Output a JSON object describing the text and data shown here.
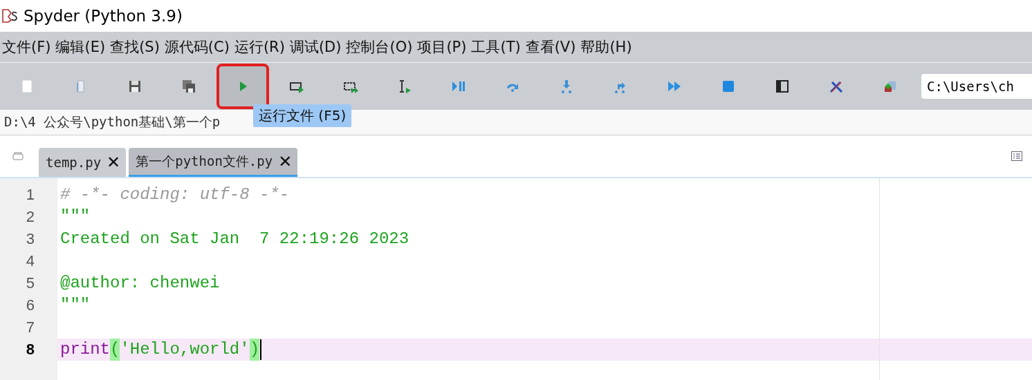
{
  "window": {
    "title": "Spyder (Python 3.9)"
  },
  "menu": [
    "文件(F)",
    "编辑(E)",
    "查找(S)",
    "源代码(C)",
    "运行(R)",
    "调试(D)",
    "控制台(O)",
    "项目(P)",
    "工具(T)",
    "查看(V)",
    "帮助(H)"
  ],
  "toolbar": {
    "buttons": [
      {
        "kind": "new",
        "highlighted": false
      },
      {
        "kind": "open",
        "highlighted": false
      },
      {
        "kind": "save",
        "highlighted": false
      },
      {
        "kind": "saveall",
        "highlighted": false
      },
      {
        "kind": "run",
        "highlighted": true
      },
      {
        "kind": "runcell",
        "highlighted": false
      },
      {
        "kind": "runcelladvance",
        "highlighted": false
      },
      {
        "kind": "runselection",
        "highlighted": false
      },
      {
        "kind": "debug",
        "highlighted": false
      },
      {
        "kind": "step",
        "highlighted": false
      },
      {
        "kind": "stepin",
        "highlighted": false
      },
      {
        "kind": "stepout",
        "highlighted": false
      },
      {
        "kind": "continue",
        "highlighted": false
      },
      {
        "kind": "stop",
        "highlighted": false
      },
      {
        "kind": "pane",
        "highlighted": false
      },
      {
        "kind": "tools",
        "highlighted": false
      },
      {
        "kind": "pythonpath",
        "highlighted": false
      }
    ],
    "directory": "C:\\Users\\ch",
    "tooltip": "运行文件 (F5)"
  },
  "file_path": "D:\\4 公众号\\python基础\\第一个p",
  "editor": {
    "tabs": [
      {
        "label": "temp.py",
        "close": "✕",
        "selected": false
      },
      {
        "label": "第一个python文件.py",
        "close": "✕",
        "selected": true
      }
    ],
    "lines": [
      {
        "number": "1",
        "current": false,
        "tokens": [
          {
            "kind": "comment",
            "text": "# -*- coding: utf-8 -*-"
          }
        ]
      },
      {
        "number": "2",
        "current": false,
        "tokens": [
          {
            "kind": "string",
            "text": "\"\"\""
          }
        ]
      },
      {
        "number": "3",
        "current": false,
        "tokens": [
          {
            "kind": "string",
            "text": "Created on Sat Jan  7 22:19:26 2023"
          }
        ]
      },
      {
        "number": "4",
        "current": false
      },
      {
        "number": "5",
        "current": false,
        "tokens": [
          {
            "kind": "string",
            "text": "@author: chenwei"
          }
        ]
      },
      {
        "number": "6",
        "current": false,
        "tokens": [
          {
            "kind": "string",
            "text": "\"\"\""
          }
        ]
      },
      {
        "number": "7",
        "current": false
      },
      {
        "number": "8",
        "current": true,
        "tokens": [
          {
            "kind": "builtin",
            "text": "print"
          },
          {
            "kind": "bracket",
            "text": "("
          },
          {
            "kind": "string",
            "text": "'Hello,world'"
          },
          {
            "kind": "bracket",
            "text": ")"
          }
        ]
      }
    ]
  }
}
